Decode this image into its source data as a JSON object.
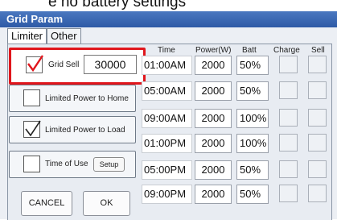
{
  "heading_partial": "e no battery settings",
  "window": {
    "title": "Grid Param"
  },
  "tabs": [
    {
      "label": "Limiter"
    },
    {
      "label": "Other"
    }
  ],
  "options": {
    "grid_sell": {
      "label": "Grid Sell",
      "value": "30000",
      "checked": true
    },
    "limited_home": {
      "label": "Limited Power to Home",
      "checked": false
    },
    "limited_load": {
      "label": "Limited Power to Load",
      "checked": true
    },
    "time_of_use": {
      "label": "Time of Use",
      "checked": false,
      "setup_label": "Setup"
    }
  },
  "buttons": {
    "cancel": "CANCEL",
    "ok": "OK"
  },
  "table": {
    "headers": {
      "time": "Time",
      "power": "Power(W)",
      "batt": "Batt",
      "charge": "Charge",
      "sell": "Sell"
    },
    "rows": [
      {
        "time": "01:00AM",
        "power": "2000",
        "batt": "50%"
      },
      {
        "time": "05:00AM",
        "power": "2000",
        "batt": "50%"
      },
      {
        "time": "09:00AM",
        "power": "2000",
        "batt": "100%"
      },
      {
        "time": "01:00PM",
        "power": "2000",
        "batt": "100%"
      },
      {
        "time": "05:00PM",
        "power": "2000",
        "batt": "50%"
      },
      {
        "time": "09:00PM",
        "power": "2000",
        "batt": "50%"
      }
    ]
  }
}
